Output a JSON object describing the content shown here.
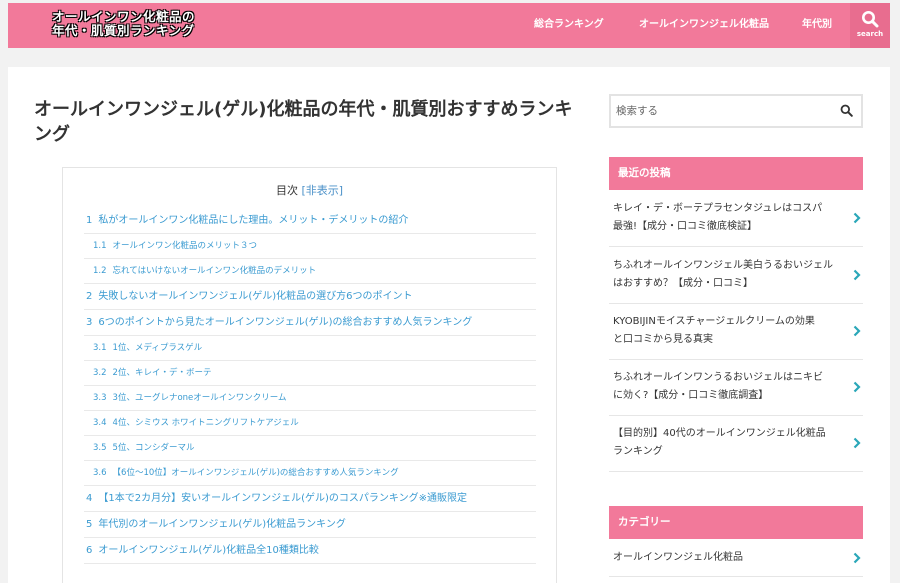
{
  "header": {
    "logo_line1": "オールインワン化粧品の",
    "logo_line2": "年代・肌質別ランキング",
    "nav": [
      "総合ランキング",
      "オールインワンジェル化粧品",
      "年代別"
    ],
    "search_label": "search"
  },
  "article": {
    "title": "オールインワンジェル(ゲル)化粧品の年代・肌質別おすすめランキング",
    "toc_title": "目次",
    "toc_toggle": "[非表示]",
    "toc": [
      {
        "num": "1",
        "text": "私がオールインワン化粧品にした理由。メリット・デメリットの紹介",
        "level": 1
      },
      {
        "num": "1.1",
        "text": "オールインワン化粧品のメリット３つ",
        "level": 2
      },
      {
        "num": "1.2",
        "text": "忘れてはいけないオールインワン化粧品のデメリット",
        "level": 2
      },
      {
        "num": "2",
        "text": "失敗しないオールインワンジェル(ゲル)化粧品の選び方6つのポイント",
        "level": 1
      },
      {
        "num": "3",
        "text": "6つのポイントから見たオールインワンジェル(ゲル)の総合おすすめ人気ランキング",
        "level": 1
      },
      {
        "num": "3.1",
        "text": "1位、メディプラスゲル",
        "level": 2
      },
      {
        "num": "3.2",
        "text": "2位、キレイ・デ・ボーテ",
        "level": 2
      },
      {
        "num": "3.3",
        "text": "3位、ユーグレナoneオールインワンクリーム",
        "level": 2
      },
      {
        "num": "3.4",
        "text": "4位、シミウス ホワイトニングリフトケアジェル",
        "level": 2
      },
      {
        "num": "3.5",
        "text": "5位、コンシダーマル",
        "level": 2
      },
      {
        "num": "3.6",
        "text": "【6位〜10位】オールインワンジェル(ゲル)の総合おすすめ人気ランキング",
        "level": 2
      },
      {
        "num": "4",
        "text": "【1本で2カ月分】安いオールインワンジェル(ゲル)のコスパランキング※通販限定",
        "level": 1
      },
      {
        "num": "5",
        "text": "年代別のオールインワンジェル(ゲル)化粧品ランキング",
        "level": 1
      },
      {
        "num": "6",
        "text": "オールインワンジェル(ゲル)化粧品全10種類比較",
        "level": 1
      }
    ]
  },
  "sidebar": {
    "search_placeholder": "検索する",
    "recent_title": "最近の投稿",
    "recent_posts": [
      {
        "line1": "キレイ・デ・ボーテプラセンタジュレはコスパ",
        "line2": "最強!【成分・口コミ徹底検証】"
      },
      {
        "line1": "ちふれオールインワンジェル美白うるおいジェル",
        "line2": "はおすすめ？【成分・口コミ】"
      },
      {
        "line1": "KYOBIJINモイスチャージェルクリームの効果",
        "line2": "と口コミから見る真実"
      },
      {
        "line1": "ちふれオールインワンうるおいジェルはニキビ",
        "line2": "に効く?【成分・口コミ徹底調査】"
      },
      {
        "line1": "【目的別】40代のオールインワンジェル化粧品",
        "line2": "ランキング"
      }
    ],
    "category_title": "カテゴリー",
    "categories": [
      "オールインワンジェル化粧品"
    ]
  },
  "colors": {
    "accent": "#f2799a",
    "link": "#3b9bd1",
    "arrow": "#2aa7b8"
  }
}
